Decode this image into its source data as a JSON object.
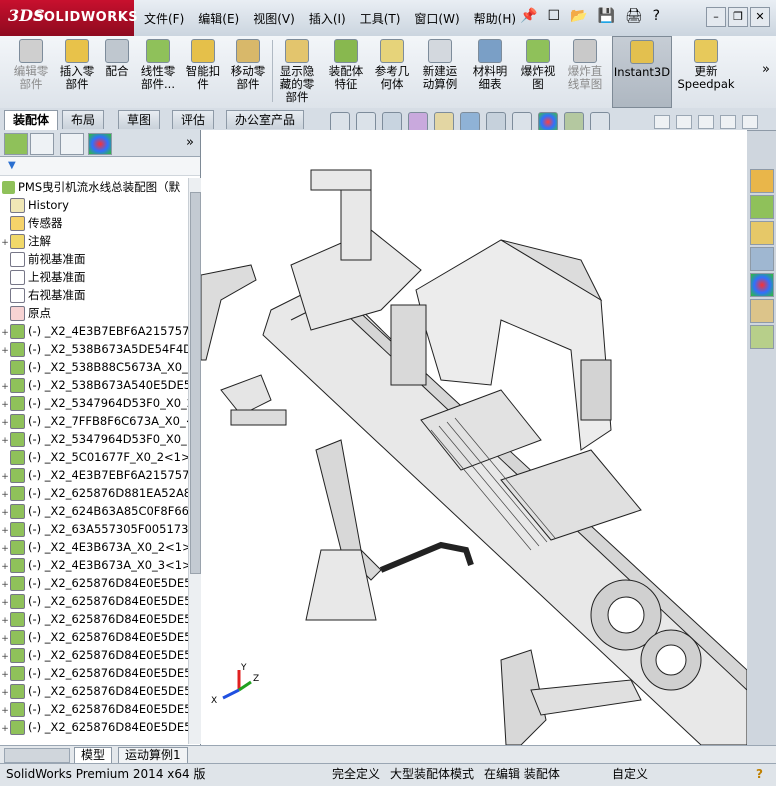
{
  "app": {
    "brand_ds": "3DS",
    "brand": "SOLIDWORKS"
  },
  "menu": [
    "文件(F)",
    "编辑(E)",
    "视图(V)",
    "插入(I)",
    "工具(T)",
    "窗口(W)",
    "帮助(H)"
  ],
  "quick_access": {
    "pin": "📌",
    "new": "☐",
    "open": "📂",
    "save": "💾",
    "print": "🖨",
    "help": "?"
  },
  "window_buttons": {
    "minimize": "–",
    "restore": "❐",
    "close": "✕"
  },
  "ribbon": [
    {
      "label": "编辑零\n部件",
      "disabled": true
    },
    {
      "label": "插入零\n部件",
      "disabled": false
    },
    {
      "label": "配合",
      "disabled": false
    },
    {
      "label": "线性零\n部件...",
      "disabled": false
    },
    {
      "label": "智能扣\n件",
      "disabled": false
    },
    {
      "label": "移动零\n部件",
      "disabled": false
    },
    {
      "label": "显示隐\n藏的零\n部件",
      "disabled": false
    },
    {
      "label": "装配体\n特征",
      "disabled": false
    },
    {
      "label": "参考几\n何体",
      "disabled": false
    },
    {
      "label": "新建运\n动算例",
      "disabled": false
    },
    {
      "label": "材料明\n细表",
      "disabled": false
    },
    {
      "label": "爆炸视\n图",
      "disabled": false
    },
    {
      "label": "爆炸直\n线草图",
      "disabled": true
    },
    {
      "label": "Instant3D",
      "disabled": false,
      "active": true
    },
    {
      "label": "更新\nSpeedpak",
      "disabled": false
    }
  ],
  "ribbon_more": "»",
  "tabs": [
    "装配体",
    "布局",
    "草图",
    "评估",
    "办公室产品"
  ],
  "active_tab": "装配体",
  "panel_more": "»",
  "filter_label": "▼",
  "tree": {
    "root": "PMS曳引机流水线总装配图（默",
    "items": [
      {
        "label": "History",
        "icon": "history-icon",
        "expand": ""
      },
      {
        "label": "传感器",
        "icon": "sensor-icon",
        "expand": ""
      },
      {
        "label": "注解",
        "icon": "annotation-icon",
        "expand": "+"
      },
      {
        "label": "前视基准面",
        "icon": "plane-icon",
        "expand": ""
      },
      {
        "label": "上视基准面",
        "icon": "plane-icon",
        "expand": ""
      },
      {
        "label": "右视基准面",
        "icon": "plane-icon",
        "expand": ""
      },
      {
        "label": "原点",
        "icon": "origin-icon",
        "expand": ""
      },
      {
        "label": "(-) _X2_4E3B7EBF6A215757_",
        "icon": "part-icon",
        "expand": "+"
      },
      {
        "label": "(-) _X2_538B673A5DE54F4D6",
        "icon": "part-icon",
        "expand": "+"
      },
      {
        "label": "(-) _X2_538B88C5673A_X0_<",
        "icon": "part-icon",
        "expand": ""
      },
      {
        "label": "(-) _X2_538B673A540E5DE54",
        "icon": "part-icon",
        "expand": "+"
      },
      {
        "label": "(-) _X2_5347964D53F0_X0_2",
        "icon": "part-icon",
        "expand": "+"
      },
      {
        "label": "(-) _X2_7FFB8F6C673A_X0_<",
        "icon": "part-icon",
        "expand": "+"
      },
      {
        "label": "(-) _X2_5347964D53F0_X0_1",
        "icon": "part-icon",
        "expand": "+"
      },
      {
        "label": "(-) _X2_5C01677F_X0_2<1>",
        "icon": "part-icon",
        "expand": ""
      },
      {
        "label": "(-) _X2_4E3B7EBF6A215757_",
        "icon": "part-icon",
        "expand": "+"
      },
      {
        "label": "(-) _X2_625876D881EA52A87",
        "icon": "part-icon",
        "expand": "+"
      },
      {
        "label": "(-) _X2_624B63A85C0F8F66_",
        "icon": "part-icon",
        "expand": "+"
      },
      {
        "label": "(-) _X2_63A557305F0051736",
        "icon": "part-icon",
        "expand": "+"
      },
      {
        "label": "(-) _X2_4E3B673A_X0_2<1>",
        "icon": "part-icon",
        "expand": "+"
      },
      {
        "label": "(-) _X2_4E3B673A_X0_3<1>",
        "icon": "part-icon",
        "expand": "+"
      },
      {
        "label": "(-) _X2_625876D84E0E5DE54",
        "icon": "part-icon",
        "expand": "+"
      },
      {
        "label": "(-) _X2_625876D84E0E5DE54",
        "icon": "part-icon",
        "expand": "+"
      },
      {
        "label": "(-) _X2_625876D84E0E5DE54",
        "icon": "part-icon",
        "expand": "+"
      },
      {
        "label": "(-) _X2_625876D84E0E5DE54",
        "icon": "part-icon",
        "expand": "+"
      },
      {
        "label": "(-) _X2_625876D84E0E5DE54",
        "icon": "part-icon",
        "expand": "+"
      },
      {
        "label": "(-) _X2_625876D84E0E5DE54",
        "icon": "part-icon",
        "expand": "+"
      },
      {
        "label": "(-) _X2_625876D84E0E5DE54",
        "icon": "part-icon",
        "expand": "+"
      },
      {
        "label": "(-) _X2_625876D84E0E5DE54",
        "icon": "part-icon",
        "expand": "+"
      },
      {
        "label": "(-) _X2_625876D84E0E5DE54",
        "icon": "part-icon",
        "expand": "+"
      }
    ]
  },
  "bottom_tabs": [
    "模型",
    "运动算例1"
  ],
  "triad": {
    "x": "X",
    "y": "Y",
    "z": "Z"
  },
  "status": {
    "product": "SolidWorks Premium 2014 x64 版",
    "fully_defined": "完全定义",
    "large_assembly": "大型装配体模式",
    "editing": "在编辑 装配体",
    "custom": "自定义",
    "help": "?"
  },
  "colors": {
    "brand": "#c8102e",
    "model_fill": "#e8e8e8",
    "model_stroke": "#222222"
  }
}
